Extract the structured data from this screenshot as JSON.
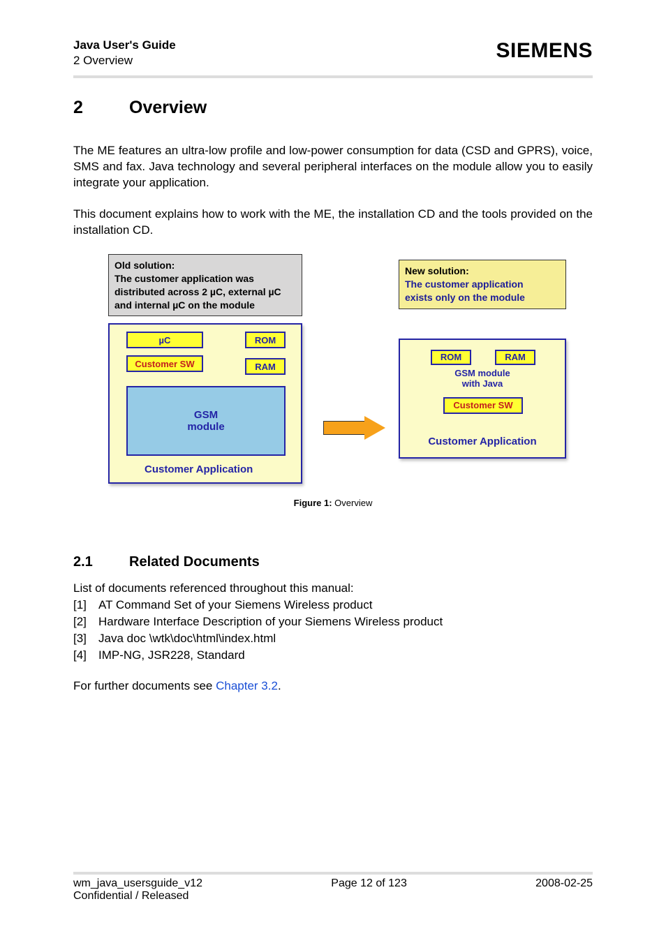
{
  "header": {
    "title": "Java User's Guide",
    "sub": "2 Overview",
    "brand": "SIEMENS"
  },
  "chapter": {
    "num": "2",
    "title": "Overview"
  },
  "para1": "The ME features an ultra-low profile and low-power consumption for data (CSD and GPRS), voice, SMS and fax. Java technology and several peripheral interfaces on the module allow you to easily integrate your application.",
  "para2": "This document explains how to work with the ME, the installation CD and the tools provided on the installation CD.",
  "figure": {
    "old_note": {
      "title": "Old solution:",
      "line1": "The customer application was",
      "line2": "distributed across 2 µC, external µC",
      "line3": "and internal µC on the module"
    },
    "new_note": {
      "title": "New solution:",
      "line1": "The customer application",
      "line2": "exists only on the module"
    },
    "left": {
      "uc": "µC",
      "rom": "ROM",
      "csw": "Customer SW",
      "ram": "RAM",
      "gsm1": "GSM",
      "gsm2": "module",
      "app": "Customer Application"
    },
    "right": {
      "rom": "ROM",
      "ram": "RAM",
      "gsm1": "GSM module",
      "gsm2": "with Java",
      "csw": "Customer SW",
      "app": "Customer Application"
    },
    "caption_b": "Figure 1:",
    "caption_t": "  Overview"
  },
  "section": {
    "num": "2.1",
    "title": "Related Documents"
  },
  "list_intro": "List of documents referenced throughout this manual:",
  "refs": [
    {
      "idx": "[1]",
      "text": "AT Command Set of your Siemens Wireless product"
    },
    {
      "idx": "[2]",
      "text": "Hardware Interface Description of your Siemens Wireless product"
    },
    {
      "idx": "[3]",
      "text": "Java doc \\wtk\\doc\\html\\index.html"
    },
    {
      "idx": "[4]",
      "text": "IMP-NG, JSR228, Standard"
    }
  ],
  "further": {
    "pre": "For further documents see ",
    "link": "Chapter 3.2",
    "post": "."
  },
  "footer": {
    "left": "wm_java_usersguide_v12",
    "center": "Page 12 of 123",
    "right": "2008-02-25",
    "sub": "Confidential / Released"
  }
}
